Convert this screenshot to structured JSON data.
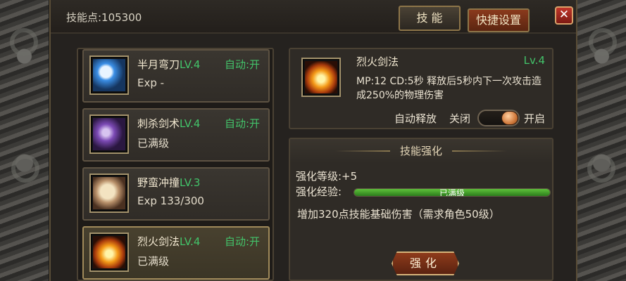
{
  "header": {
    "skill_points": "技能点:105300"
  },
  "tabs": {
    "skill": "技 能",
    "shortcut": "快捷设置"
  },
  "close_label": "✕",
  "skills": [
    {
      "name": "半月弯刀",
      "level": "LV.4",
      "auto": "自动:开",
      "sub": "Exp -",
      "icon": "crescent-blade-icon"
    },
    {
      "name": "刺杀剑术",
      "level": "LV.4",
      "auto": "自动:开",
      "sub": "已满级",
      "icon": "assassin-sword-icon"
    },
    {
      "name": "野蛮冲撞",
      "level": "LV.3",
      "auto": "",
      "sub": "Exp 133/300",
      "icon": "barbaric-charge-icon"
    },
    {
      "name": "烈火剑法",
      "level": "LV.4",
      "auto": "自动:开",
      "sub": "已满级",
      "icon": "blazing-sword-icon"
    }
  ],
  "detail": {
    "name": "烈火剑法",
    "level": "Lv.4",
    "description": "MP:12  CD:5秒  释放后5秒内下一次攻击造成250%的物理伤害",
    "auto_release_label": "自动释放",
    "off_label": "关闭",
    "on_label": "开启",
    "toggle_on": true
  },
  "enhance": {
    "title": "技能强化",
    "level_label": "强化等级:+5",
    "exp_label": "强化经验:",
    "exp_bar_text": "已满级",
    "exp_fraction": 1.0,
    "effect": "增加320点技能基础伤害（需求角色50级）",
    "button_label": "强化"
  },
  "colors": {
    "level_green": "#43c36a",
    "accent_gold": "#a08a5a",
    "button_red": "#8e3b1b"
  }
}
